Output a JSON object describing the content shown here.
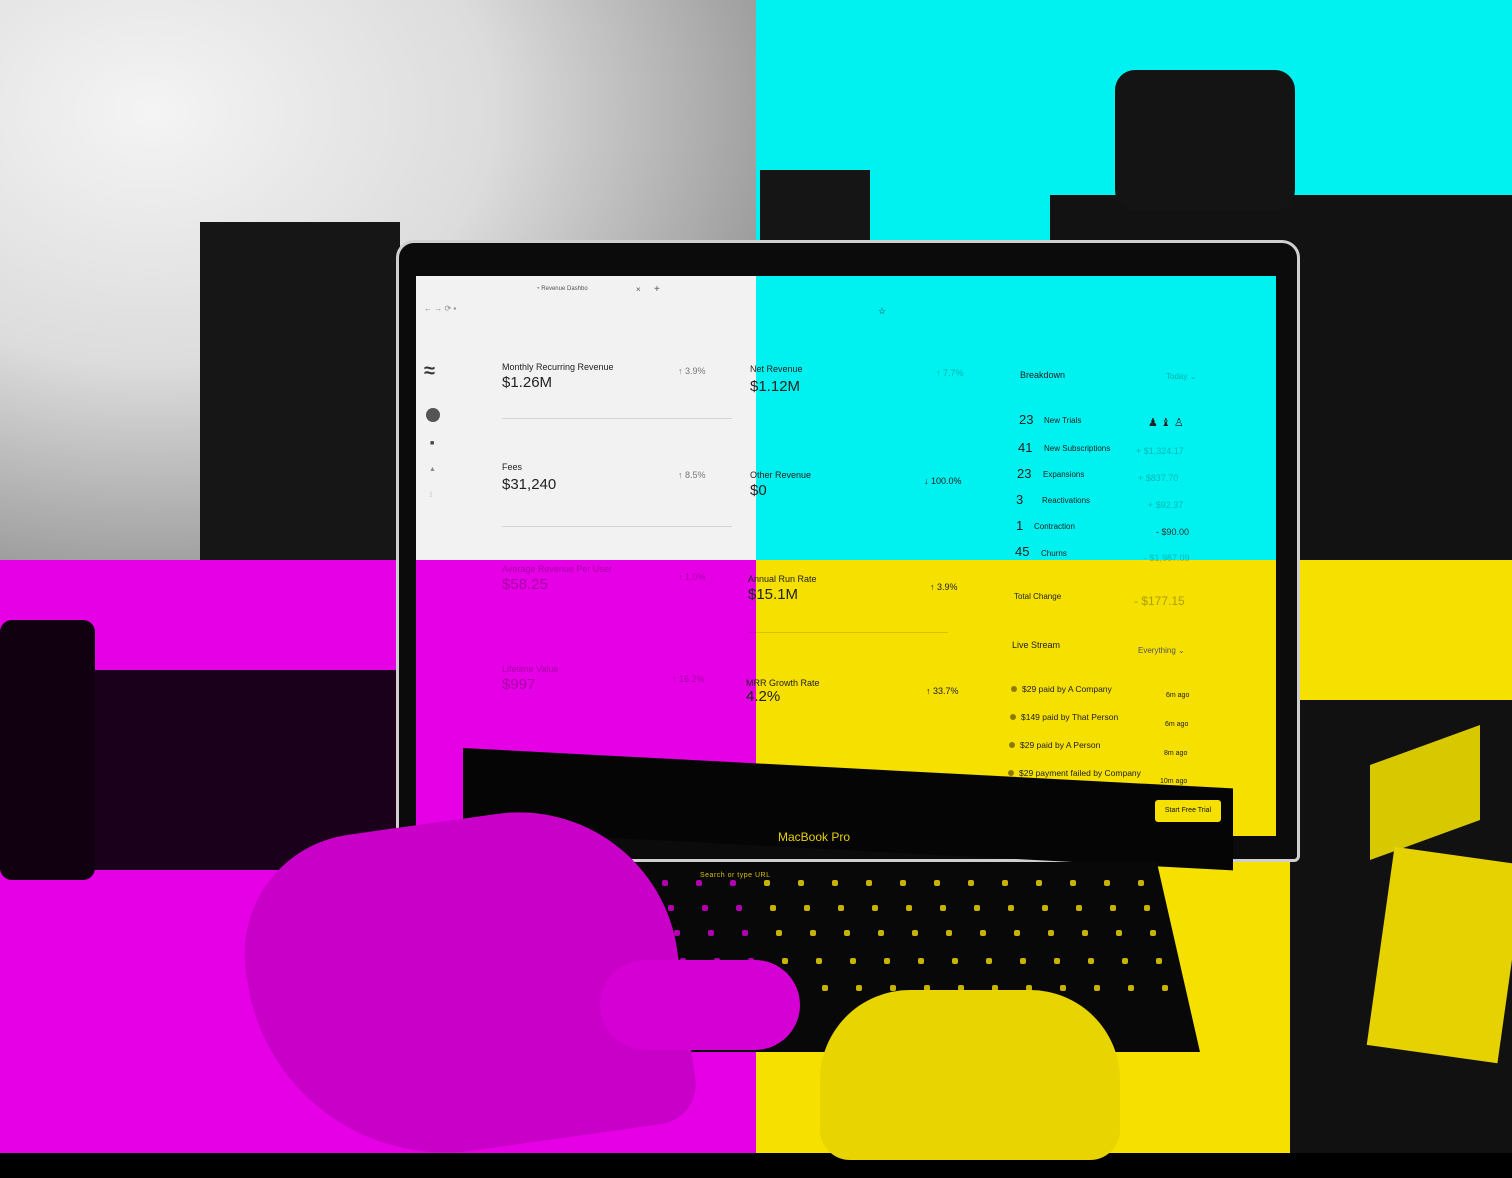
{
  "browser": {
    "tab_title": "Revenue Dashbo",
    "tab_close": "×",
    "new_tab": "+",
    "bookmark": "☆"
  },
  "metrics": [
    {
      "label": "Monthly Recurring Revenue",
      "value": "$1.26M",
      "change": "↑ 3.9%"
    },
    {
      "label": "Net Revenue",
      "value": "$1.12M",
      "change": "↑ 7.7%"
    },
    {
      "label": "Fees",
      "value": "$31,240",
      "change": "↑ 8.5%"
    },
    {
      "label": "Other Revenue",
      "value": "$0",
      "change": "↓ 100.0%"
    },
    {
      "label": "Average Revenue Per User",
      "value": "$58.25",
      "change": "↑ 1.0%"
    },
    {
      "label": "Annual Run Rate",
      "value": "$15.1M",
      "change": "↑ 3.9%"
    },
    {
      "label": "Lifetime Value",
      "value": "$997",
      "change": "↑ 16.2%"
    },
    {
      "label": "MRR Growth Rate",
      "value": "4.2%",
      "change": "↑ 33.7%"
    }
  ],
  "breakdown": {
    "title": "Breakdown",
    "period": "Today ⌄",
    "rows": [
      {
        "count": "23",
        "label": "New Trials",
        "amount": ""
      },
      {
        "count": "41",
        "label": "New Subscriptions",
        "amount": "+ $1,324.17"
      },
      {
        "count": "23",
        "label": "Expansions",
        "amount": "+ $837.70"
      },
      {
        "count": "3",
        "label": "Reactivations",
        "amount": "+ $92.37"
      },
      {
        "count": "1",
        "label": "Contraction",
        "amount": "- $90.00"
      },
      {
        "count": "45",
        "label": "Churns",
        "amount": "- $1,987.09"
      }
    ],
    "total_label": "Total Change",
    "total_value": "- $177.15"
  },
  "live_stream": {
    "title": "Live Stream",
    "filter": "Everything ⌄",
    "items": [
      {
        "text": "$29 paid by A Company",
        "time": "6m ago"
      },
      {
        "text": "$149 paid by That Person",
        "time": "6m ago"
      },
      {
        "text": "$29 paid by A Person",
        "time": "8m ago"
      },
      {
        "text": "$29 payment failed by Company",
        "time": "10m ago"
      }
    ]
  },
  "cta_label": "Start Free Trial",
  "laptop_brand": "MacBook Pro",
  "touchbar_hint": "Search or type URL",
  "colors": {
    "cyan": "#00f2f0",
    "magenta": "#e600e6",
    "yellow": "#f5e000",
    "gray": "#dcdcdc"
  }
}
